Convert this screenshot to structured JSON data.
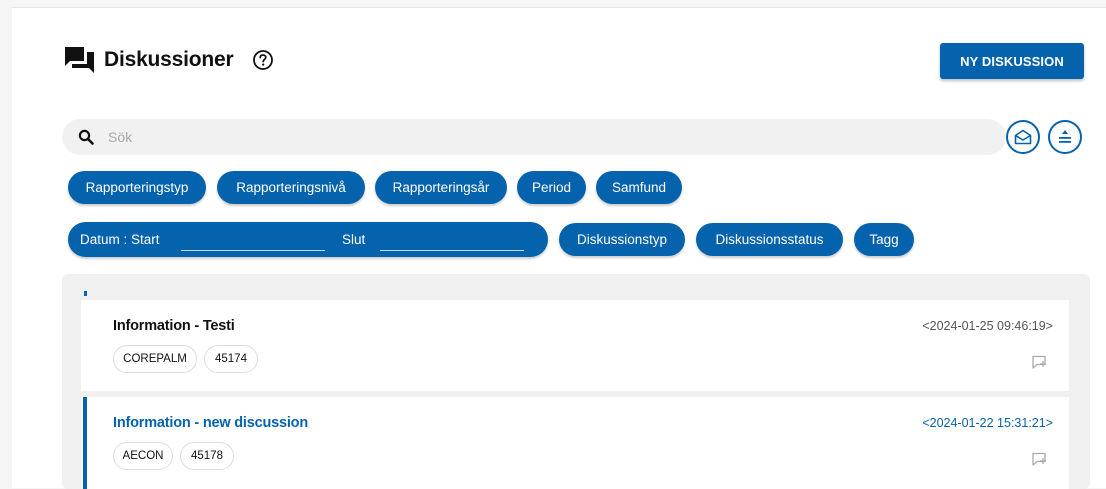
{
  "header": {
    "title": "Diskussioner",
    "new_button": "NY DISKUSSION"
  },
  "search": {
    "placeholder": "Sök"
  },
  "filters": {
    "row1": [
      "Rapporteringstyp",
      "Rapporteringsnivå",
      "Rapporteringsår",
      "Period",
      "Samfund"
    ],
    "date": {
      "start_label": "Datum : Start",
      "end_label": "Slut"
    },
    "row2": [
      "Diskussionstyp",
      "Diskussionsstatus",
      "Tagg"
    ]
  },
  "discussions": [
    {
      "title": "Information - Testi",
      "timestamp": "<2024-01-25 09:46:19>",
      "tags": [
        "COREPALM",
        "45174"
      ]
    },
    {
      "title": "Information - new discussion",
      "timestamp": "<2024-01-22 15:31:21>",
      "tags": [
        "AECON",
        "45178"
      ]
    }
  ],
  "colors": {
    "primary": "#0563ad",
    "background": "#ffffff",
    "list_background": "#f0f0f0"
  },
  "icons": {
    "header": "discussion-icon",
    "help": "help-icon",
    "search": "search-icon",
    "mail": "mail-open-icon",
    "sort": "sort-icon",
    "reply": "reply-icon"
  }
}
